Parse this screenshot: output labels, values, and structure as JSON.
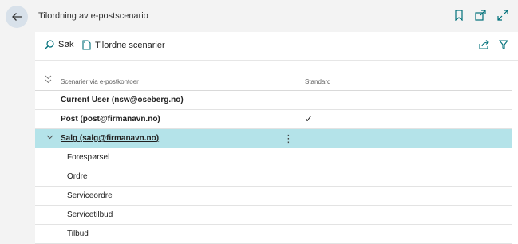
{
  "window": {
    "title": "Tilordning av e-postscenario",
    "icons": [
      "bookmark-icon",
      "popout-icon",
      "expand-icon"
    ]
  },
  "toolbar": {
    "search_label": "Søk",
    "assign_label": "Tilordne scenarier",
    "right_icons": [
      "share-icon",
      "filter-icon"
    ]
  },
  "table": {
    "columns": [
      "Scenarier via e-postkontoer",
      "Standard"
    ],
    "rows": [
      {
        "label": "Current User (nsw@oseberg.no)",
        "standard": ""
      },
      {
        "label": "Post (post@firmanavn.no)",
        "standard": "✓"
      },
      {
        "label": "Salg (salg@firmanavn.no)",
        "standard": ""
      },
      {
        "label": "Forespørsel",
        "standard": ""
      },
      {
        "label": "Ordre",
        "standard": ""
      },
      {
        "label": "Serviceordre",
        "standard": ""
      },
      {
        "label": "Servicetilbud",
        "standard": ""
      },
      {
        "label": "Tilbud",
        "standard": ""
      }
    ]
  },
  "colors": {
    "selected_row": "#b4e3e9",
    "accent": "#00707a"
  }
}
